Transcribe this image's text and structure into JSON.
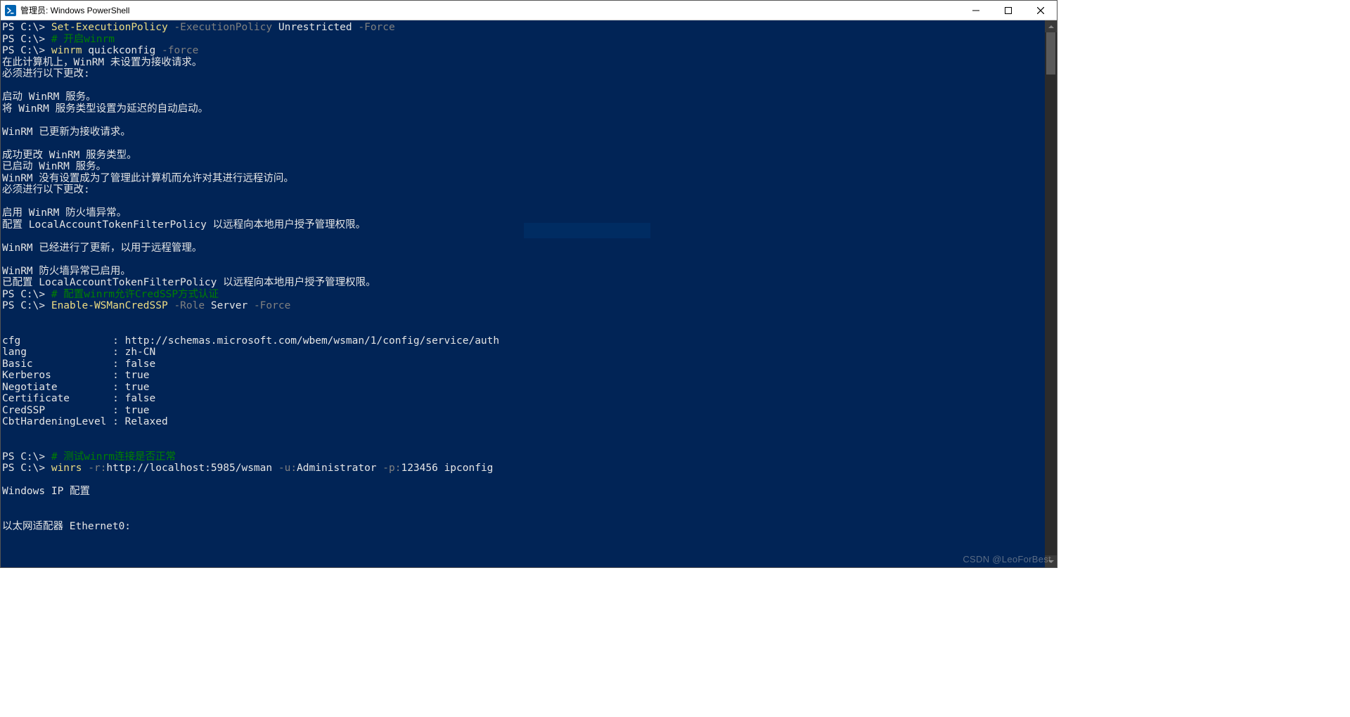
{
  "titlebar": {
    "title": "管理员: Windows PowerShell"
  },
  "prompt": "PS C:\\> ",
  "lines": {
    "l1_cmd": "Set-ExecutionPolicy",
    "l1_param1": " -ExecutionPolicy",
    "l1_val1": " Unrestricted",
    "l1_param2": " -Force",
    "l2_comment": "# 开启winrm",
    "l3_cmd": "winrm",
    "l3_arg": " quickconfig",
    "l3_param": " -force",
    "o1": "在此计算机上，WinRM 未设置为接收请求。",
    "o2": "必须进行以下更改:",
    "o3": "",
    "o4": "启动 WinRM 服务。",
    "o5": "将 WinRM 服务类型设置为延迟的自动启动。",
    "o6": "",
    "o7": "WinRM 已更新为接收请求。",
    "o8": "",
    "o9": "成功更改 WinRM 服务类型。",
    "o10": "已启动 WinRM 服务。",
    "o11": "WinRM 没有设置成为了管理此计算机而允许对其进行远程访问。",
    "o12": "必须进行以下更改:",
    "o13": "",
    "o14": "启用 WinRM 防火墙异常。",
    "o15": "配置 LocalAccountTokenFilterPolicy 以远程向本地用户授予管理权限。",
    "o16": "",
    "o17": "WinRM 已经进行了更新，以用于远程管理。",
    "o18": "",
    "o19": "WinRM 防火墙异常已启用。",
    "o20": "已配置 LocalAccountTokenFilterPolicy 以远程向本地用户授予管理权限。",
    "l4_comment": "# 配置winrm允许CredSSP方式认证",
    "l5_cmd": "Enable-WSManCredSSP",
    "l5_param1": " -Role",
    "l5_val1": " Server",
    "l5_param2": " -Force",
    "o21": "",
    "o22": "",
    "o23": "cfg               : http://schemas.microsoft.com/wbem/wsman/1/config/service/auth",
    "o24": "lang              : zh-CN",
    "o25": "Basic             : false",
    "o26": "Kerberos          : true",
    "o27": "Negotiate         : true",
    "o28": "Certificate       : false",
    "o29": "CredSSP           : true",
    "o30": "CbtHardeningLevel : Relaxed",
    "o31": "",
    "o32": "",
    "l6_comment": "# 测试winrm连接是否正常",
    "l7_cmd": "winrs",
    "l7_p1": " -r:",
    "l7_v1": "http://localhost:5985/wsman",
    "l7_p2": " -u:",
    "l7_v2": "Administrator",
    "l7_p3": " -p:",
    "l7_v3": "123456 ipconfig",
    "o33": "",
    "o34": "Windows IP 配置",
    "o35": "",
    "o36": "",
    "o37": "以太网适配器 Ethernet0:"
  },
  "watermark": "CSDN @LeoForBest"
}
